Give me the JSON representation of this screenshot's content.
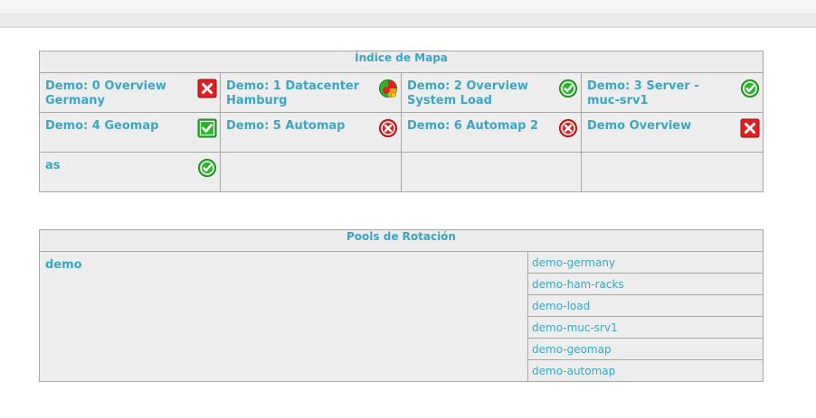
{
  "map_index": {
    "title": "Índice de Mapa",
    "rows": [
      [
        {
          "label": "Demo: 0 Overview Germany",
          "status": "critical-square-icon"
        },
        {
          "label": "Demo: 1 Datacenter Hamburg",
          "status": "warning-mixed-icon"
        },
        {
          "label": "Demo: 2 Overview System Load",
          "status": "ok-circle-icon"
        },
        {
          "label": "Demo: 3 Server - muc-srv1",
          "status": "ok-circle-icon"
        }
      ],
      [
        {
          "label": "Demo: 4 Geomap",
          "status": "ok-square-icon"
        },
        {
          "label": "Demo: 5 Automap",
          "status": "critical-circle-icon"
        },
        {
          "label": "Demo: 6 Automap 2",
          "status": "critical-circle-icon"
        },
        {
          "label": "Demo Overview",
          "status": "critical-square-icon"
        }
      ],
      [
        {
          "label": "as",
          "status": "ok-circle-icon"
        }
      ]
    ]
  },
  "rotation_pools": {
    "title": "Pools de Rotación",
    "pool": "demo",
    "maps": [
      "demo-germany",
      "demo-ham-racks",
      "demo-load",
      "demo-muc-srv1",
      "demo-geomap",
      "demo-automap"
    ]
  },
  "colors": {
    "link": "#3aa6c4",
    "ok": "#2bb52b",
    "critical": "#e02020",
    "cell_bg": "#ededed",
    "border": "#a6a6a6"
  }
}
